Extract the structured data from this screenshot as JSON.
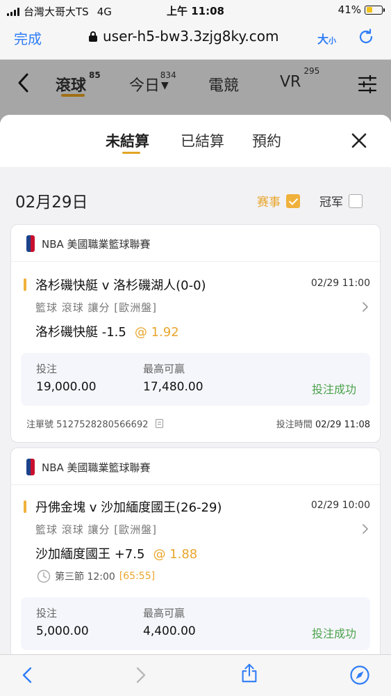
{
  "status_bar": {
    "carrier": "台灣大哥大TS",
    "network": "4G",
    "time": "上午 11:08",
    "battery": "41%",
    "battery_level": 0.41
  },
  "browser": {
    "done_label": "完成",
    "url": "user-h5-bw3.3zjg8ky.com",
    "text_size_label": "大",
    "text_size_small": "小"
  },
  "app_nav": {
    "items": [
      {
        "label": "滾球",
        "count": "85"
      },
      {
        "label": "今日",
        "count": "834"
      },
      {
        "label": "電競",
        "count": ""
      },
      {
        "label": "VR",
        "count": "295"
      }
    ]
  },
  "sheet": {
    "tabs": [
      "未結算",
      "已結算",
      "預約"
    ],
    "active_tab": "未結算"
  },
  "date_header": "02月29日",
  "filters": [
    {
      "label": "赛事",
      "checked": true,
      "color": "#e9a52b"
    },
    {
      "label": "冠军",
      "checked": false,
      "color": "#333333"
    }
  ],
  "bets": [
    {
      "league": "NBA 美國職業籃球聯賽",
      "match": "洛杉磯快艇 v 洛杉磯湖人(0-0)",
      "match_time": "02/29 11:00",
      "bet_type": "籃球  滾球  讓分 [歐洲盤]",
      "pick": "洛杉磯快艇 -1.5",
      "odds": "@ 1.92",
      "period": "",
      "period_score": "",
      "stake_label": "投注",
      "stake": "19,000.00",
      "max_win_label": "最高可贏",
      "max_win": "17,480.00",
      "status": "投注成功",
      "order_label": "注單號",
      "order_no": "5127528280566692",
      "bet_time_label": "投注時間",
      "bet_time": "02/29 11:08"
    },
    {
      "league": "NBA 美國職業籃球聯賽",
      "match": "丹佛金塊 v 沙加緬度國王(26-29)",
      "match_time": "02/29 10:00",
      "bet_type": "籃球  滾球  讓分 [歐洲盤]",
      "pick": "沙加緬度國王 +7.5",
      "odds": "@ 1.88",
      "period": "第三節  12:00",
      "period_score": "[65:55]",
      "stake_label": "投注",
      "stake": "5,000.00",
      "max_win_label": "最高可贏",
      "max_win": "4,400.00",
      "status": "投注成功"
    }
  ],
  "colors": {
    "accent": "#e9a52b",
    "link": "#2f7df6",
    "success": "#4aa14a"
  }
}
